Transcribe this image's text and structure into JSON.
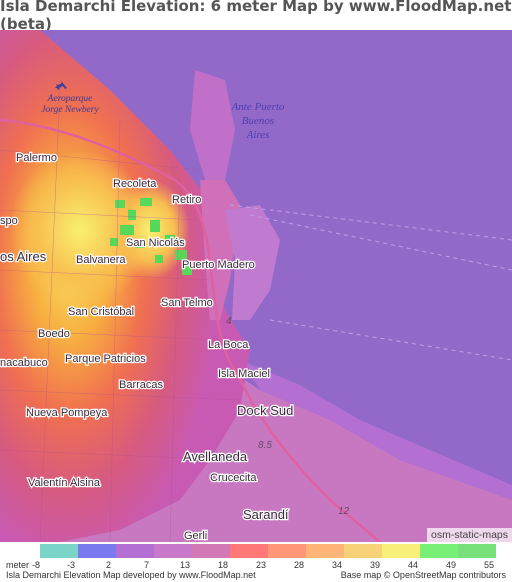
{
  "title": "Isla Demarchi Elevation: 6 meter Map by www.FloodMap.net (beta)",
  "map": {
    "water_labels": [
      "Ante Puerto",
      "Buenos",
      "Aires"
    ],
    "airport_labels": [
      "Aeroparque",
      "Jorge Newbery"
    ],
    "places": {
      "palermo": "Palermo",
      "recoleta": "Recoleta",
      "retiro": "Retiro",
      "spo": "spo",
      "os_aires": "os Aires",
      "san_nicolas": "San Nicolás",
      "balvanera": "Balvanera",
      "puerto_madero": "Puerto Madero",
      "san_cristobal": "San Cristóbal",
      "san_telmo": "San Telmo",
      "boedo": "Boedo",
      "la_boca": "La Boca",
      "nacabuco": "nacabuco",
      "parque_patricios": "Parque Patricios",
      "isla_maciel": "Isla Maciel",
      "barracas": "Barracas",
      "nueva_pompeya": "Nueva Pompeya",
      "dock_sud": "Dock Sud",
      "avellaneda": "Avellaneda",
      "valentin_alsina": "Valentín Alsina",
      "crucecita": "Crucecita",
      "sarandi": "Sarandí",
      "gerli": "Gerli"
    },
    "road_labels": [
      "4",
      "8.5",
      "12"
    ],
    "attribution": "osm-static-maps"
  },
  "legend": {
    "unit": "meter",
    "colors": [
      "#7ad4c8",
      "#7a7aee",
      "#b46fd2",
      "#c878c8",
      "#d278b4",
      "#ff7878",
      "#ff9678",
      "#ffb478",
      "#f8d278",
      "#f8f078",
      "#78f078",
      "#78e078"
    ],
    "labels": [
      "-8",
      "-3",
      "2",
      "7",
      "13",
      "18",
      "23",
      "28",
      "34",
      "39",
      "44",
      "49",
      "55"
    ]
  },
  "footer": {
    "left": "Isla Demarchi Elevation Map developed by www.FloodMap.net",
    "right": "Base map © OpenStreetMap contributors"
  }
}
